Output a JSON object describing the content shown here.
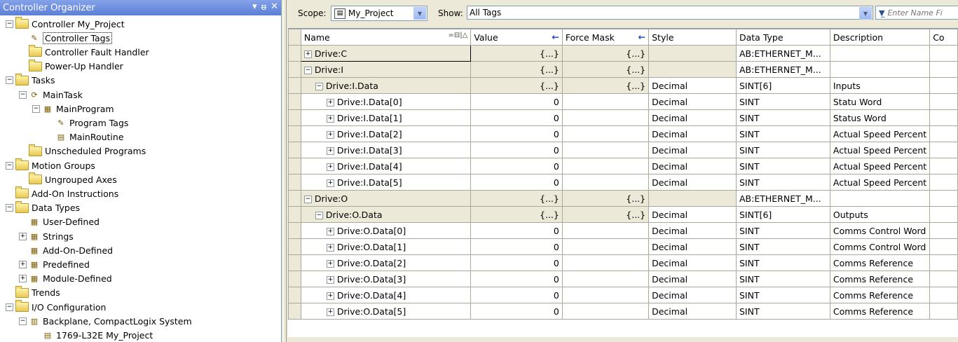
{
  "organizer": {
    "title": "Controller Organizer",
    "controls": [
      "▾",
      "ᵿ",
      "✕"
    ]
  },
  "tree": [
    {
      "label": "Controller My_Project",
      "icon": "folder-icon",
      "expander": "−"
    },
    {
      "label": "Controller Tags",
      "icon": "tags-icon",
      "selected": true
    },
    {
      "label": "Controller Fault Handler",
      "icon": "folder-icon"
    },
    {
      "label": "Power-Up Handler",
      "icon": "folder-icon"
    },
    {
      "label": "Tasks",
      "icon": "folder-icon",
      "expander": "−"
    },
    {
      "label": "MainTask",
      "icon": "task-icon",
      "expander": "−"
    },
    {
      "label": "MainProgram",
      "icon": "program-icon",
      "expander": "−"
    },
    {
      "label": "Program Tags",
      "icon": "tags-icon"
    },
    {
      "label": "MainRoutine",
      "icon": "routine-icon"
    },
    {
      "label": "Unscheduled Programs",
      "icon": "folder-icon"
    },
    {
      "label": "Motion Groups",
      "icon": "folder-icon",
      "expander": "−"
    },
    {
      "label": "Ungrouped Axes",
      "icon": "folder-icon"
    },
    {
      "label": "Add-On Instructions",
      "icon": "folder-icon"
    },
    {
      "label": "Data Types",
      "icon": "folder-icon",
      "expander": "−"
    },
    {
      "label": "User-Defined",
      "icon": "datatype-icon"
    },
    {
      "label": "Strings",
      "icon": "datatype-icon",
      "expander": "+"
    },
    {
      "label": "Add-On-Defined",
      "icon": "datatype-icon"
    },
    {
      "label": "Predefined",
      "icon": "datatype-icon",
      "expander": "+"
    },
    {
      "label": "Module-Defined",
      "icon": "datatype-icon",
      "expander": "+"
    },
    {
      "label": "Trends",
      "icon": "folder-icon"
    },
    {
      "label": "I/O Configuration",
      "icon": "folder-icon",
      "expander": "−"
    },
    {
      "label": "Backplane, CompactLogix System",
      "icon": "backplane-icon",
      "expander": "−"
    },
    {
      "label": "1769-L32E My_Project",
      "icon": "controller-icon"
    }
  ],
  "toolbar": {
    "scope_label": "Scope:",
    "scope_value": "My_Project",
    "show_label": "Show:",
    "show_value": "All Tags",
    "filter_placeholder": "Enter Name Fi"
  },
  "columns": [
    "Name",
    "Value",
    "Force Mask",
    "Style",
    "Data Type",
    "Description",
    "Co"
  ],
  "rows": [
    {
      "name": "Drive:C",
      "indent": 0,
      "exp": "+",
      "value": "{...}",
      "force": "{...}",
      "style": "",
      "type": "AB:ETHERNET_M...",
      "desc": ""
    },
    {
      "name": "Drive:I",
      "indent": 0,
      "exp": "−",
      "value": "{...}",
      "force": "{...}",
      "style": "",
      "type": "AB:ETHERNET_M...",
      "desc": ""
    },
    {
      "name": "Drive:I.Data",
      "indent": 1,
      "exp": "−",
      "value": "{...}",
      "force": "{...}",
      "style": "Decimal",
      "type": "SINT[6]",
      "desc": "Inputs"
    },
    {
      "name": "Drive:I.Data[0]",
      "indent": 2,
      "exp": "+",
      "value": "0",
      "force": "",
      "style": "Decimal",
      "type": "SINT",
      "desc": "Statu Word"
    },
    {
      "name": "Drive:I.Data[1]",
      "indent": 2,
      "exp": "+",
      "value": "0",
      "force": "",
      "style": "Decimal",
      "type": "SINT",
      "desc": "Status Word"
    },
    {
      "name": "Drive:I.Data[2]",
      "indent": 2,
      "exp": "+",
      "value": "0",
      "force": "",
      "style": "Decimal",
      "type": "SINT",
      "desc": "Actual Speed Percent"
    },
    {
      "name": "Drive:I.Data[3]",
      "indent": 2,
      "exp": "+",
      "value": "0",
      "force": "",
      "style": "Decimal",
      "type": "SINT",
      "desc": "Actual Speed Percent"
    },
    {
      "name": "Drive:I.Data[4]",
      "indent": 2,
      "exp": "+",
      "value": "0",
      "force": "",
      "style": "Decimal",
      "type": "SINT",
      "desc": "Actual Speed Percent"
    },
    {
      "name": "Drive:I.Data[5]",
      "indent": 2,
      "exp": "+",
      "value": "0",
      "force": "",
      "style": "Decimal",
      "type": "SINT",
      "desc": "Actual Speed Percent"
    },
    {
      "name": "Drive:O",
      "indent": 0,
      "exp": "−",
      "value": "{...}",
      "force": "{...}",
      "style": "",
      "type": "AB:ETHERNET_M...",
      "desc": ""
    },
    {
      "name": "Drive:O.Data",
      "indent": 1,
      "exp": "−",
      "value": "{...}",
      "force": "{...}",
      "style": "Decimal",
      "type": "SINT[6]",
      "desc": "Outputs"
    },
    {
      "name": "Drive:O.Data[0]",
      "indent": 2,
      "exp": "+",
      "value": "0",
      "force": "",
      "style": "Decimal",
      "type": "SINT",
      "desc": "Comms Control Word"
    },
    {
      "name": "Drive:O.Data[1]",
      "indent": 2,
      "exp": "+",
      "value": "0",
      "force": "",
      "style": "Decimal",
      "type": "SINT",
      "desc": "Comms Control Word"
    },
    {
      "name": "Drive:O.Data[2]",
      "indent": 2,
      "exp": "+",
      "value": "0",
      "force": "",
      "style": "Decimal",
      "type": "SINT",
      "desc": "Comms Reference"
    },
    {
      "name": "Drive:O.Data[3]",
      "indent": 2,
      "exp": "+",
      "value": "0",
      "force": "",
      "style": "Decimal",
      "type": "SINT",
      "desc": "Comms Reference"
    },
    {
      "name": "Drive:O.Data[4]",
      "indent": 2,
      "exp": "+",
      "value": "0",
      "force": "",
      "style": "Decimal",
      "type": "SINT",
      "desc": "Comms Reference"
    },
    {
      "name": "Drive:O.Data[5]",
      "indent": 2,
      "exp": "+",
      "value": "0",
      "force": "",
      "style": "Decimal",
      "type": "SINT",
      "desc": "Comms Reference"
    }
  ],
  "colors": {
    "title_bar": "#5c80d8",
    "grid_shade": "#ece9d8",
    "force_arrow": "#1a3fbf"
  }
}
